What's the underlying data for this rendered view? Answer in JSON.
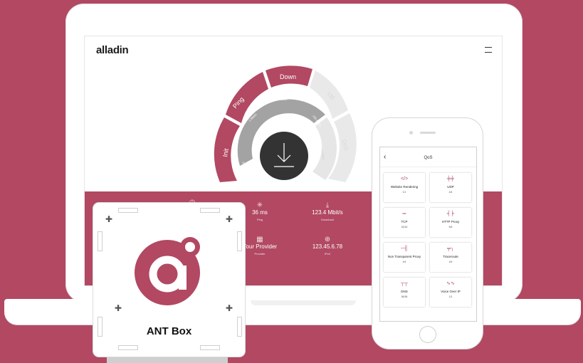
{
  "app": {
    "logo": "alladin",
    "menu_icon": "hamburger-icon"
  },
  "gauge": {
    "outer_labels": [
      "Init",
      "Ping",
      "Down",
      "Up",
      "QoS"
    ],
    "inner_labels": [
      "0",
      "1 Mbit/s",
      "10 Mbit/s",
      "100 Mbit/s",
      "1 Gbit/s"
    ],
    "center_icon": "download-arrow-icon"
  },
  "stats": [
    {
      "value": "",
      "label": "",
      "icon": "clock-icon"
    },
    {
      "value": "36 ms",
      "label": "Ping",
      "icon": "ping-icon"
    },
    {
      "value": "123.4 Mbit/s",
      "label": "Download",
      "icon": "download-icon"
    },
    {
      "value": "Your Provider",
      "label": "Provider",
      "icon": "provider-icon"
    },
    {
      "value": "123.45.6.78",
      "label": "IPv4",
      "icon": "ip-icon"
    }
  ],
  "phone": {
    "title": "QoS",
    "back_icon": "chevron-left-icon",
    "tiles": [
      {
        "name": "Website Rendering",
        "status": "1/1",
        "icon": "code-icon"
      },
      {
        "name": "UDP",
        "status": "4/4",
        "icon": "udp-icon"
      },
      {
        "name": "TCP",
        "status": "16/16",
        "icon": "tcp-icon"
      },
      {
        "name": "HTTP Proxy",
        "status": "6/6",
        "icon": "proxy-icon"
      },
      {
        "name": "Non Transparent Proxy",
        "status": "4/4",
        "icon": "ntp-icon"
      },
      {
        "name": "Traceroute",
        "status": "4/4",
        "icon": "traceroute-icon"
      },
      {
        "name": "DNS",
        "status": "36/36",
        "icon": "dns-icon"
      },
      {
        "name": "Voice Over IP",
        "status": "1/1",
        "icon": "voip-icon"
      }
    ]
  },
  "box": {
    "title": "ANT Box",
    "logo_letter": "a"
  },
  "colors": {
    "brand": "#b24862",
    "gauge_active": "#b24862",
    "gauge_inactive": "#e8e8e8",
    "gauge_inner": "#a3a3a3",
    "center": "#333333"
  }
}
